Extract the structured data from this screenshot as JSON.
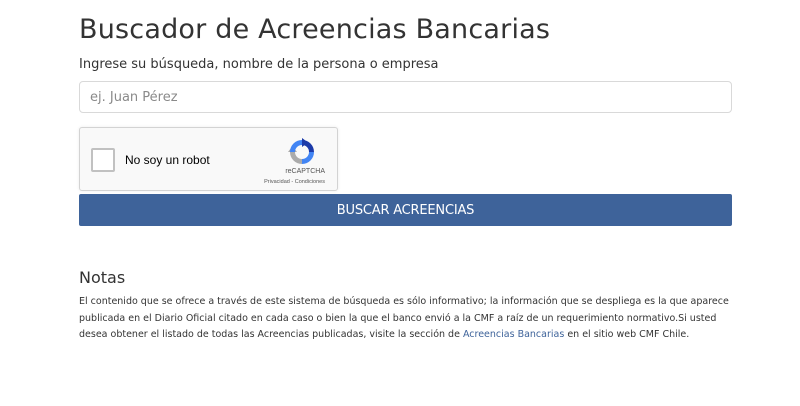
{
  "page": {
    "title": "Buscador de Acreencias Bancarias"
  },
  "search": {
    "label": "Ingrese su búsqueda, nombre de la persona o empresa",
    "placeholder": "ej. Juan Pérez",
    "value": ""
  },
  "recaptcha": {
    "label": "No soy un robot",
    "brand": "reCAPTCHA",
    "privacy": "Privacidad",
    "separator": " - ",
    "terms": "Condiciones",
    "checked": false
  },
  "button": {
    "label": "BUSCAR ACREENCIAS"
  },
  "notes": {
    "title": "Notas",
    "text_before": "El contenido que se ofrece a través de este sistema de búsqueda es sólo informativo; la información que se despliega es la que aparece publicada en el Diario Oficial citado en cada caso o bien la que el banco envió a la CMF a raíz de un requerimiento normativo.Si usted desea obtener el listado de todas las Acreencias publicadas, visite la sección de ",
    "link_text": "Acreencias Bancarias",
    "text_after": " en el sitio web CMF Chile."
  },
  "colors": {
    "primary": "#3e639a",
    "text": "#333333",
    "border": "#d9d9d9",
    "recaptcha_bg": "#f9f9f9"
  },
  "icons": {
    "recaptcha_logo": "recaptcha-logo-icon"
  }
}
